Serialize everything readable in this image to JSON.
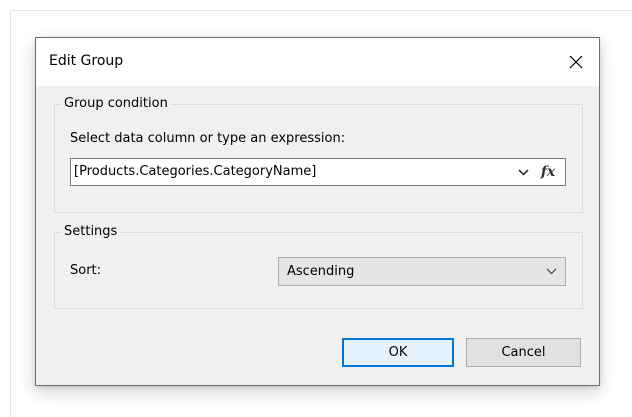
{
  "dialog": {
    "title": "Edit Group",
    "close_icon": "close-icon"
  },
  "group_condition": {
    "legend": "Group condition",
    "prompt": "Select data column or type an expression:",
    "expression_value": "[Products.Categories.CategoryName]",
    "dropdown_icon": "chevron-down-icon",
    "fx_label": "fx"
  },
  "settings": {
    "legend": "Settings",
    "sort_label": "Sort:",
    "sort_value": "Ascending",
    "sort_options_visible": [
      "Ascending"
    ],
    "dropdown_icon": "chevron-down-icon"
  },
  "buttons": {
    "ok_label": "OK",
    "cancel_label": "Cancel"
  },
  "colors": {
    "dialog_bg": "#f0f0f0",
    "titlebar_bg": "#ffffff",
    "default_button_border": "#0078d7"
  }
}
